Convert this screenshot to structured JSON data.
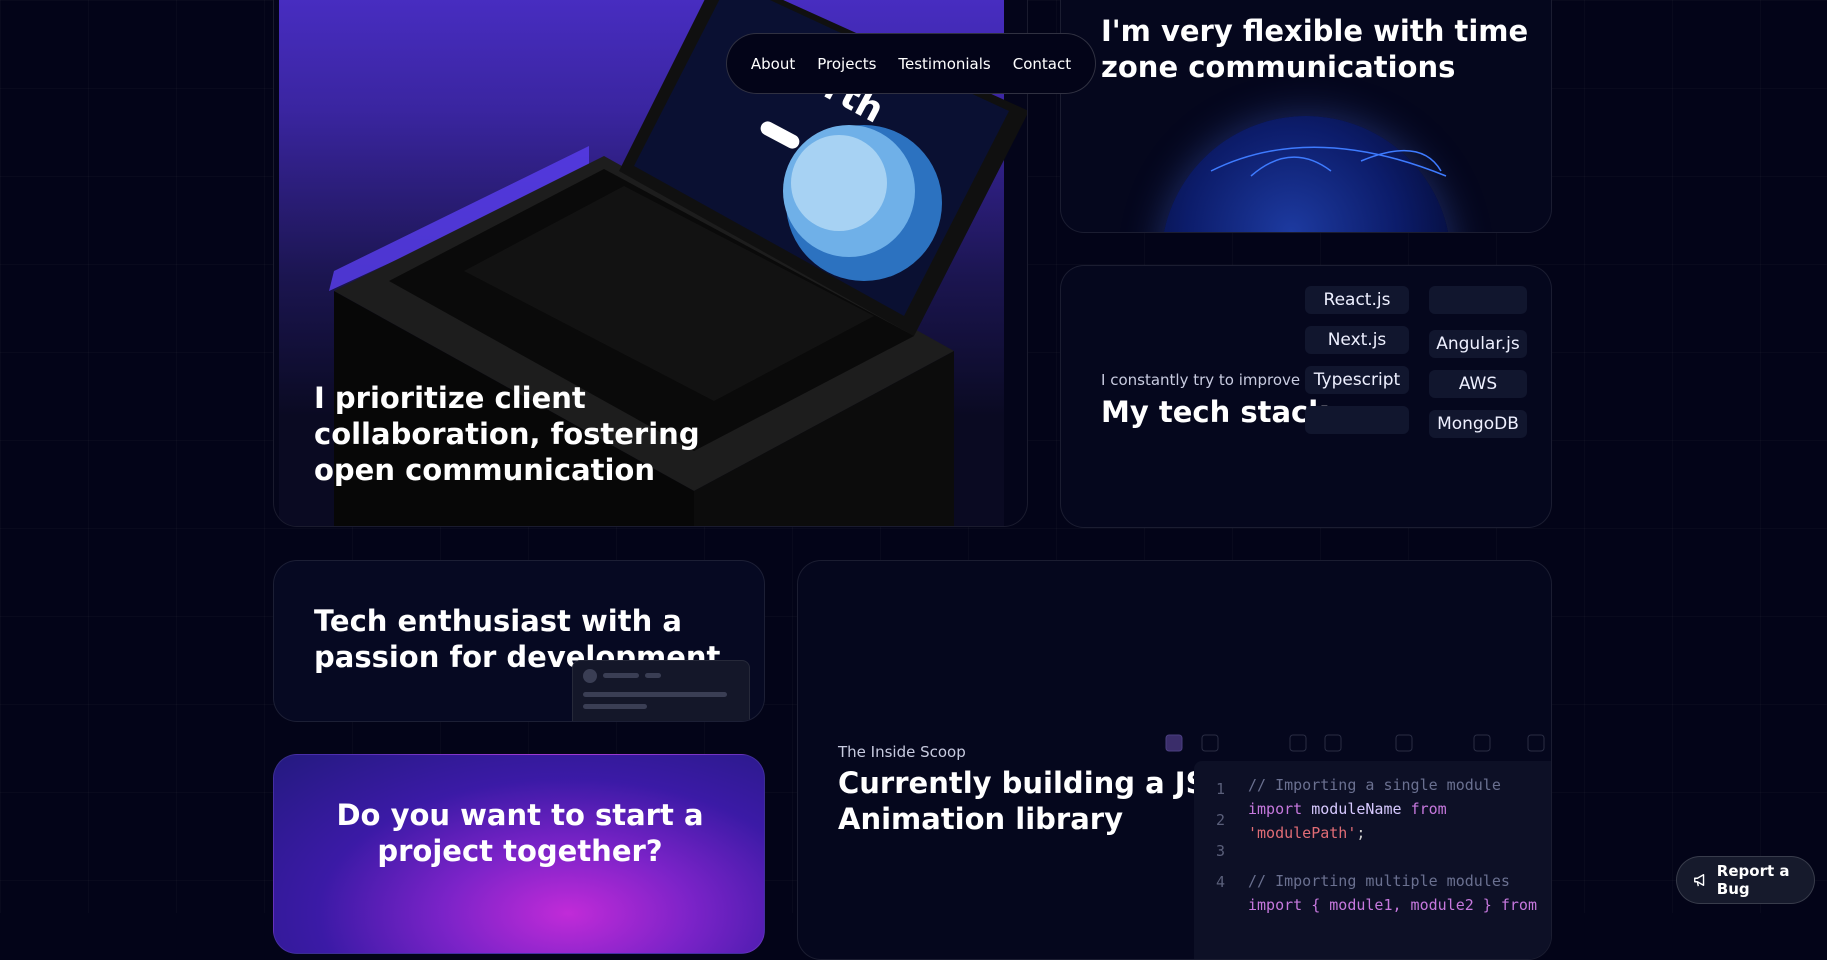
{
  "nav": {
    "items": [
      "About",
      "Projects",
      "Testimonials",
      "Contact"
    ]
  },
  "laptop_card": {
    "heading": [
      "I prioritize client",
      "collaboration, fostering",
      "open communication"
    ],
    "screen_title": "earth"
  },
  "globe_card": {
    "heading": [
      "I'm very flexible with time",
      "zone communications"
    ]
  },
  "stack_card": {
    "subtitle": "I constantly try to improve",
    "heading": "My tech stack",
    "left_pills": [
      "React.js",
      "Next.js",
      "Typescript",
      ""
    ],
    "right_pills": [
      "",
      "Angular.js",
      "AWS",
      "MongoDB"
    ]
  },
  "enthusiast_card": {
    "heading": [
      "Tech enthusiast with a",
      "passion for development."
    ]
  },
  "project_card": {
    "heading": [
      "Do you want to start a",
      "project together?"
    ]
  },
  "scoop_card": {
    "subtitle": "The Inside Scoop",
    "heading": [
      "Currently building a JS",
      "Animation library"
    ],
    "code_lines": [
      {
        "n": "1",
        "comment": "// Importing a single module"
      },
      {
        "n": "2",
        "kw1": "import",
        "name": " moduleName ",
        "kw2": "from",
        "str": "'modulePath'",
        "end": ";"
      },
      {
        "n": "3"
      },
      {
        "n": "4",
        "comment": "// Importing multiple modules",
        "partial": "import { module1, module2 } from"
      }
    ]
  },
  "bug_button": {
    "label": "Report a Bug"
  },
  "colors": {
    "bg": "#030418",
    "accent_purple": "#4b2fc9",
    "code_keyword": "#c678dd",
    "code_string": "#e06c75"
  }
}
